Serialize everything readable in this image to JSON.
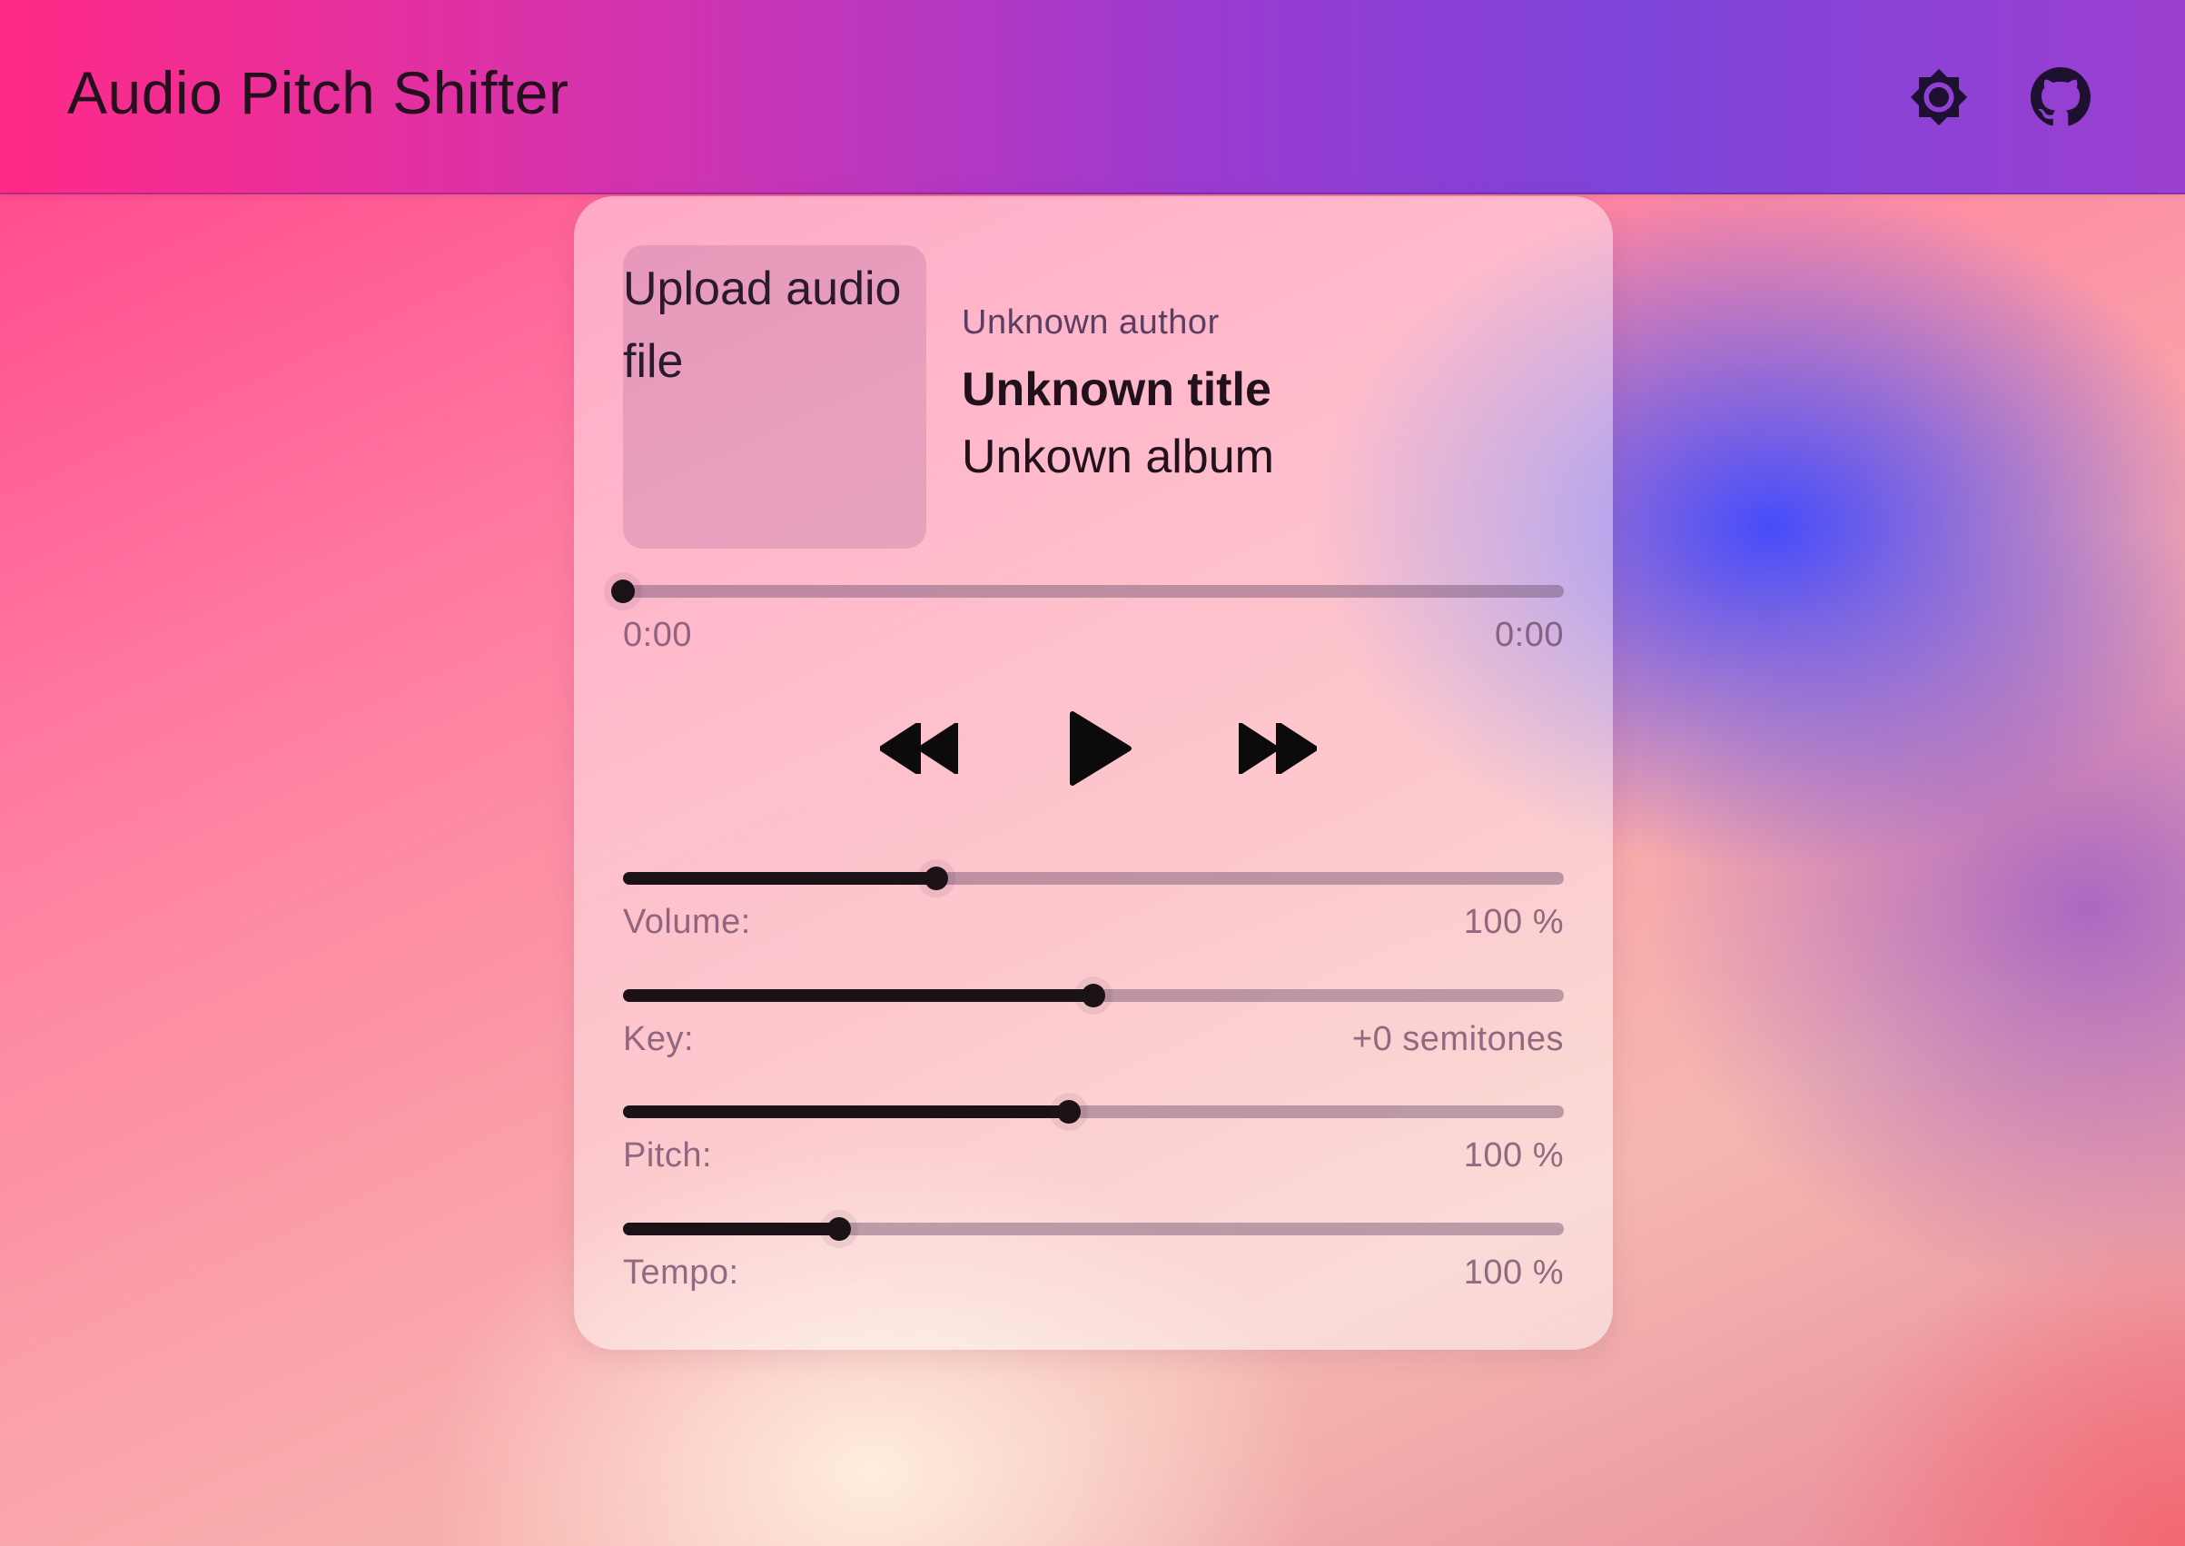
{
  "app": {
    "title": "Audio Pitch Shifter"
  },
  "toolbar": {
    "icons": [
      "brightness-icon",
      "github-icon"
    ]
  },
  "player": {
    "upload_label": "Upload audio file",
    "author": "Unknown author",
    "title": "Unknown title",
    "album": "Unkown album",
    "position": {
      "current": "0:00",
      "duration": "0:00",
      "fraction": 0.0
    },
    "controls": [
      "rewind-icon",
      "play-icon",
      "fast-forward-icon"
    ]
  },
  "sliders": [
    {
      "label": "Volume:",
      "value": "100 %",
      "fraction": 0.333
    },
    {
      "label": "Key:",
      "value": "+0 semitones",
      "fraction": 0.5
    },
    {
      "label": "Pitch:",
      "value": "100 %",
      "fraction": 0.474
    },
    {
      "label": "Tempo:",
      "value": "100 %",
      "fraction": 0.23
    }
  ],
  "colors": {
    "text": "#22101c",
    "accent": "#1a1216"
  }
}
